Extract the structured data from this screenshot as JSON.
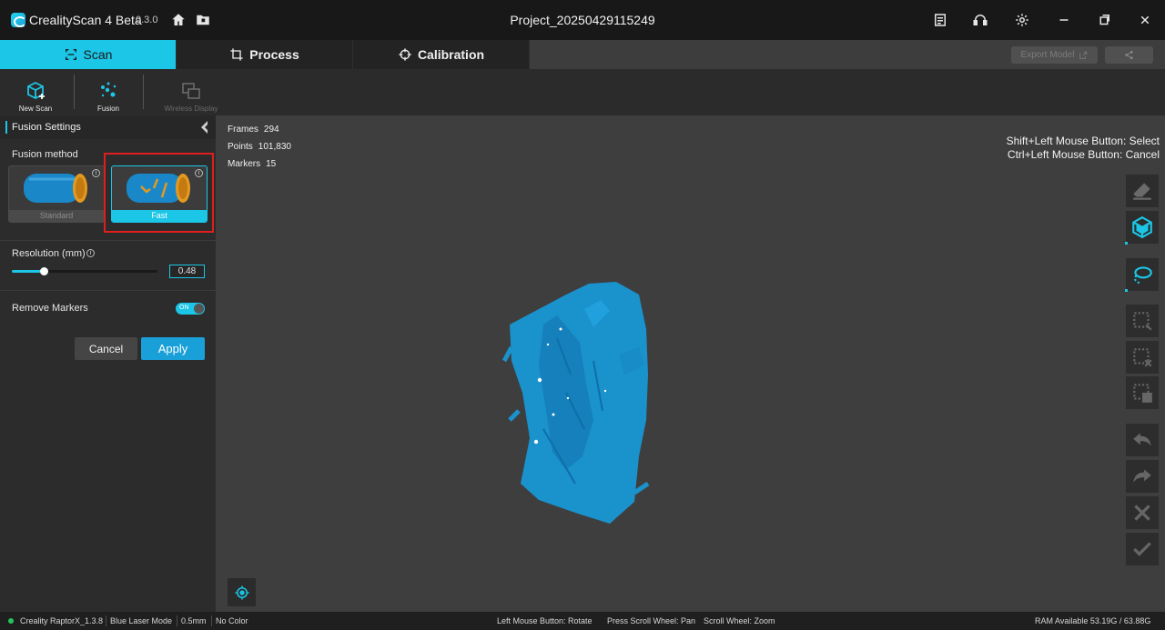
{
  "app": {
    "name": "CrealityScan 4 Beta",
    "version": "0.3.0",
    "project_title": "Project_20250429115249"
  },
  "mode_tabs": [
    {
      "label": "Scan",
      "icon": "scan-frame-icon",
      "active": true
    },
    {
      "label": "Process",
      "icon": "crop-icon",
      "active": false
    },
    {
      "label": "Calibration",
      "icon": "crosshair-icon",
      "active": false
    }
  ],
  "header_actions": {
    "export_label": "Export Model",
    "share_icon": "share-icon"
  },
  "toolbar": {
    "new_scan": "New Scan",
    "fusion": "Fusion",
    "wireless_display": "Wireless Display"
  },
  "panel": {
    "title": "Fusion Settings",
    "fusion_method_label": "Fusion method",
    "methods": [
      {
        "label": "Standard",
        "selected": false
      },
      {
        "label": "Fast",
        "selected": true
      }
    ],
    "resolution_label": "Resolution (mm)",
    "resolution_value": "0.48",
    "resolution_fraction": 0.22,
    "remove_markers_label": "Remove Markers",
    "remove_markers_state": "ON",
    "cancel_label": "Cancel",
    "apply_label": "Apply"
  },
  "stats": {
    "frames_label": "Frames",
    "frames": "294",
    "points_label": "Points",
    "points": "101,830",
    "markers_label": "Markers",
    "markers": "15"
  },
  "hints": {
    "select": "Shift+Left Mouse Button: Select",
    "cancel": "Ctrl+Left Mouse Button: Cancel"
  },
  "right_tools": [
    {
      "icon": "eraser-icon",
      "active": false
    },
    {
      "icon": "cube-view-icon",
      "active": true
    },
    {
      "icon": "lasso-select-icon",
      "active": true
    },
    {
      "icon": "rect-select-icon",
      "active": false
    },
    {
      "icon": "rect-deselect-icon",
      "active": false
    },
    {
      "icon": "rect-delete-icon",
      "active": false
    },
    {
      "icon": "undo-icon",
      "active": false
    },
    {
      "icon": "redo-icon",
      "active": false
    },
    {
      "icon": "close-icon",
      "active": false
    },
    {
      "icon": "check-icon",
      "active": false
    }
  ],
  "status": {
    "device": "Creality RaptorX_1.3.8",
    "mode": "Blue Laser Mode",
    "resolution": "0.5mm",
    "color": "No Color",
    "rotate": "Left Mouse Button: Rotate",
    "pan": "Press Scroll Wheel: Pan",
    "zoom": "Scroll Wheel: Zoom",
    "ram": "RAM Available 53.19G / 63.88G"
  },
  "colors": {
    "accent": "#1bc6e6",
    "apply": "#1aa0d8",
    "scan_blue": "#1a92cc",
    "highlight": "#e11d1d"
  }
}
